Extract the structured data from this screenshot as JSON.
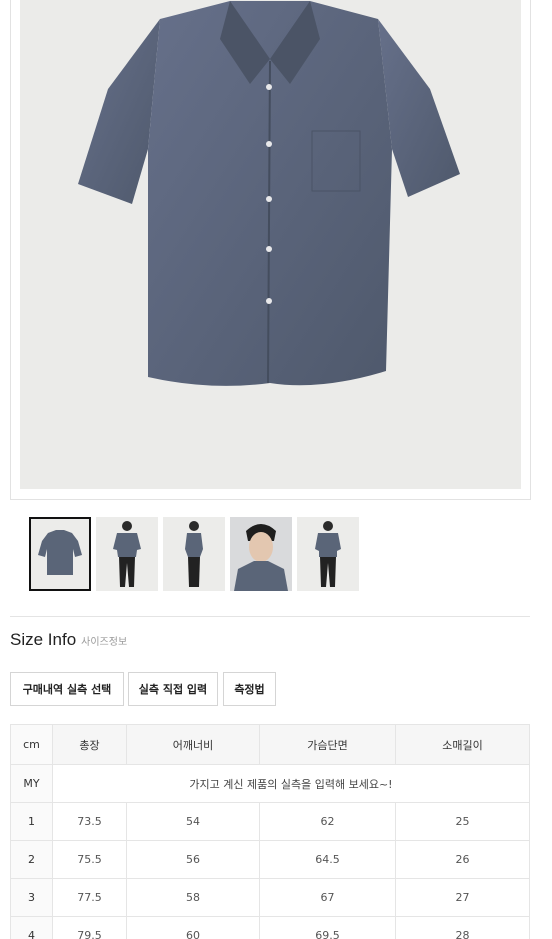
{
  "product": {
    "main_image": "gray-blue short-sleeve button-up shirt",
    "thumbnails": [
      {
        "name": "shirt flat-lay",
        "active": true
      },
      {
        "name": "model full body front",
        "active": false
      },
      {
        "name": "model full body side",
        "active": false
      },
      {
        "name": "model close-up",
        "active": false
      },
      {
        "name": "model full body front 2",
        "active": false
      }
    ]
  },
  "size_info": {
    "title": "Size Info",
    "subtitle": "사이즈정보",
    "buttons": [
      "구매내역 실측 선택",
      "실측 직접 입력",
      "측정법"
    ]
  },
  "size_table": {
    "unit": "cm",
    "columns": [
      "총장",
      "어깨너비",
      "가슴단면",
      "소매길이"
    ],
    "my_row_label": "MY",
    "my_row_note": "가지고 계신 제품의 실측을 입력해 보세요~!",
    "rows": [
      {
        "size": "1",
        "values": [
          "73.5",
          "54",
          "62",
          "25"
        ]
      },
      {
        "size": "2",
        "values": [
          "75.5",
          "56",
          "64.5",
          "26"
        ]
      },
      {
        "size": "3",
        "values": [
          "77.5",
          "58",
          "67",
          "27"
        ]
      },
      {
        "size": "4",
        "values": [
          "79.5",
          "60",
          "69.5",
          "28"
        ]
      }
    ]
  },
  "colors": {
    "shirt": "#5a6578",
    "background": "#ebebe9",
    "border": "#e5e5e5",
    "header_bg": "#f6f6f6"
  }
}
